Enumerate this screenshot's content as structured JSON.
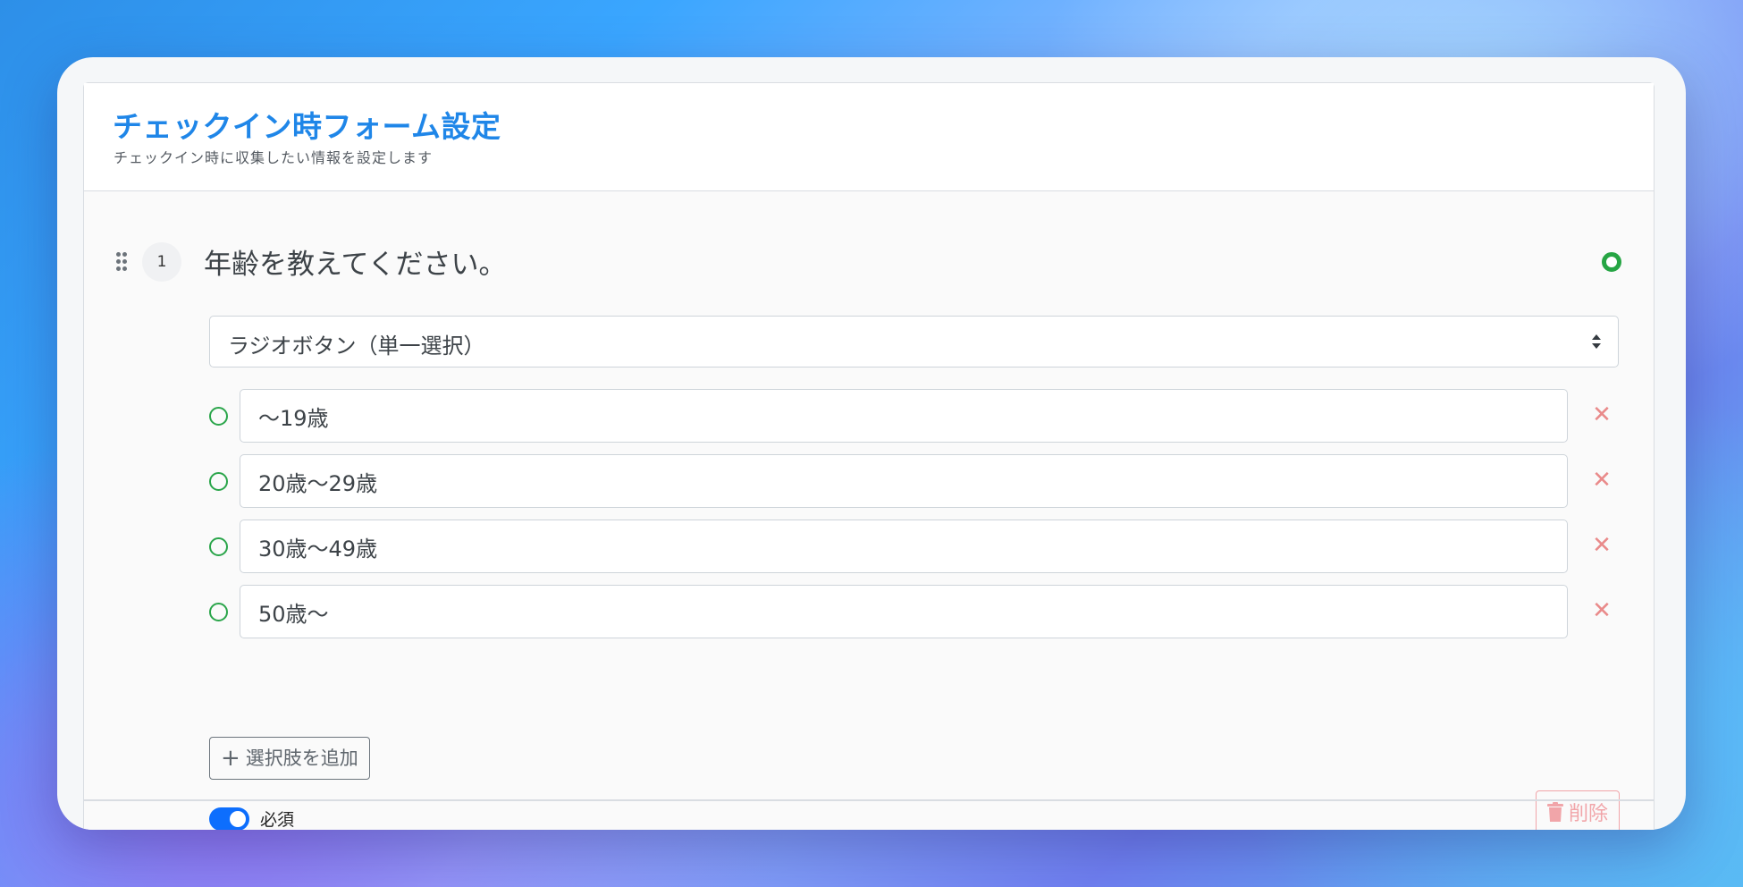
{
  "header": {
    "title": "チェックイン時フォーム設定",
    "subtitle": "チェックイン時に収集したい情報を設定します"
  },
  "question": {
    "number": "1",
    "title": "年齢を教えてください。",
    "type_select": {
      "selected": "ラジオボタン（単一選択）"
    },
    "options": [
      {
        "value": "〜19歳"
      },
      {
        "value": "20歳〜29歳"
      },
      {
        "value": "30歳〜49歳"
      },
      {
        "value": "50歳〜"
      }
    ],
    "add_option_label": "選択肢を追加",
    "required_label": "必須",
    "required_on": true,
    "delete_label": "削除"
  },
  "icons": {
    "drag": "drag-handle-icon",
    "status": "status-dot-icon",
    "select_arrows": "sort-arrows-icon",
    "radio": "radio-circle-icon",
    "remove": "close-icon",
    "add": "plus-icon",
    "delete": "trash-icon"
  },
  "colors": {
    "title": "#1f86e8",
    "status_green": "#26a544",
    "toggle_blue": "#0d6efd",
    "danger_light": "#f1a5a9",
    "remove_red": "#e98a8a"
  }
}
